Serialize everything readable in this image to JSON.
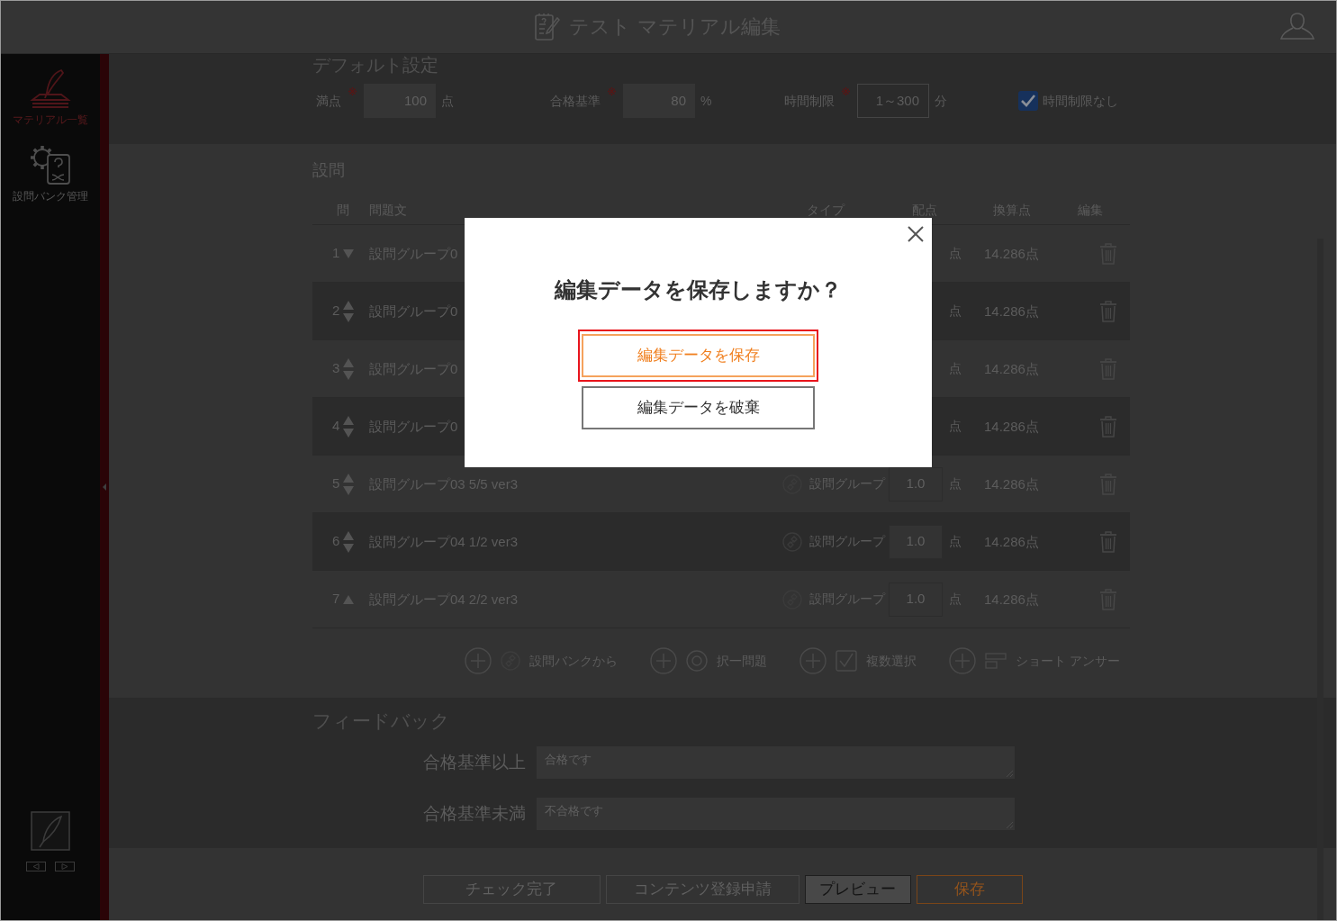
{
  "header": {
    "title": "テスト マテリアル編集"
  },
  "sidebar": {
    "items": [
      {
        "label": "マテリアル一覧",
        "selected": true
      },
      {
        "label": "設問バンク管理",
        "selected": false
      }
    ]
  },
  "default_settings": {
    "title": "デフォルト設定",
    "fields": [
      {
        "label": "満点",
        "required": true,
        "disabled": false,
        "value": "100",
        "unit": "点"
      },
      {
        "label": "合格基準",
        "required": true,
        "disabled": false,
        "value": "80",
        "unit": "%"
      },
      {
        "label": "時間制限",
        "required": true,
        "disabled": true,
        "placeholder": "1～300",
        "unit": "分"
      }
    ],
    "no_time_limit": {
      "label": "時間制限なし",
      "checked": true
    }
  },
  "questions": {
    "title": "設問",
    "columns": [
      "問",
      "問題文",
      "タイプ",
      "配点",
      "換算点",
      "編集"
    ],
    "rows": [
      {
        "number": "1",
        "move_up": false,
        "move_down": true,
        "text": "設問グループ0",
        "unit": "点",
        "points": "14.286点"
      },
      {
        "number": "2",
        "move_up": true,
        "move_down": true,
        "text": "設問グループ0",
        "unit": "点",
        "points": "14.286点"
      },
      {
        "number": "3",
        "move_up": true,
        "move_down": true,
        "text": "設問グループ0",
        "unit": "点",
        "points": "14.286点"
      },
      {
        "number": "4",
        "move_up": true,
        "move_down": true,
        "text": "設問グループ0",
        "unit": "点",
        "points": "14.286点"
      },
      {
        "number": "5",
        "move_up": true,
        "move_down": true,
        "text": "設問グループ03 5/5 ver3",
        "type": "設問グループ",
        "score": "1.0",
        "unit": "点",
        "points": "14.286点"
      },
      {
        "number": "6",
        "move_up": true,
        "move_down": true,
        "text": "設問グループ04 1/2 ver3",
        "type": "設問グループ",
        "score": "1.0",
        "unit": "点",
        "points": "14.286点"
      },
      {
        "number": "7",
        "move_up": true,
        "move_down": false,
        "text": "設問グループ04 2/2 ver3",
        "type": "設問グループ",
        "score": "1.0",
        "unit": "点",
        "points": "14.286点"
      }
    ],
    "add_buttons": [
      {
        "kind": "bank",
        "label": "設問バンクから"
      },
      {
        "kind": "single",
        "label": "択一問題"
      },
      {
        "kind": "multiple",
        "label": "複数選択"
      },
      {
        "kind": "short",
        "label": "ショート アンサー"
      }
    ]
  },
  "feedback": {
    "title": "フィードバック",
    "fields": [
      {
        "label": "合格基準以上",
        "value": "合格です"
      },
      {
        "label": "合格基準未満",
        "value": "不合格です"
      }
    ]
  },
  "footer_buttons": [
    {
      "kind": "disabled",
      "label": "チェック完了"
    },
    {
      "kind": "disabled",
      "label": "コンテンツ登録申請"
    },
    {
      "kind": "default",
      "label": "プレビュー"
    },
    {
      "kind": "primary",
      "label": "保存"
    }
  ],
  "dialog": {
    "title": "編集データを保存しますか？",
    "buttons": [
      {
        "kind": "primary",
        "label": "編集データを保存",
        "highlighted": true
      },
      {
        "kind": "secondary",
        "label": "編集データを破棄",
        "highlighted": false
      }
    ]
  }
}
